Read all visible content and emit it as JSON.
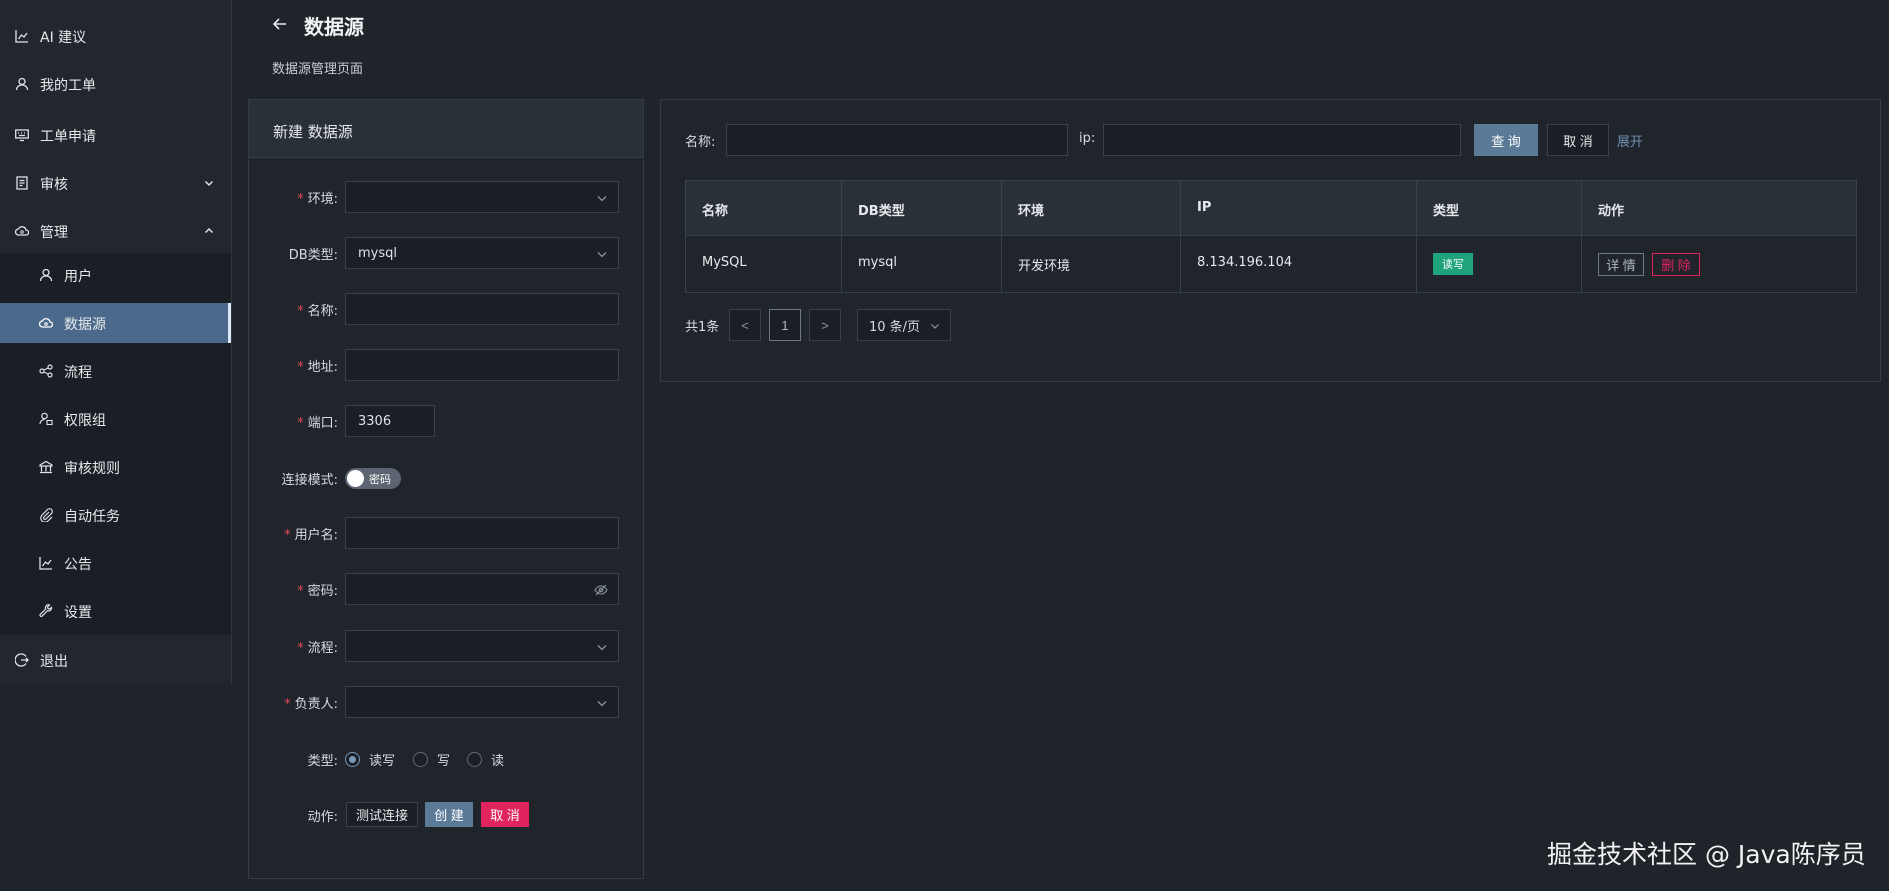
{
  "sidebar": {
    "items": [
      {
        "label": "AI 建议",
        "icon": "chart-icon"
      },
      {
        "label": "我的工单",
        "icon": "user-icon"
      },
      {
        "label": "工单申请",
        "icon": "keyboard-icon"
      },
      {
        "label": "审核",
        "icon": "clipboard-icon"
      },
      {
        "label": "管理",
        "icon": "cloud-gear-icon"
      },
      {
        "label": "退出",
        "icon": "logout-icon"
      }
    ],
    "sub_items": [
      {
        "label": "用户",
        "icon": "user-icon"
      },
      {
        "label": "数据源",
        "icon": "cloud-gear-icon",
        "active": true
      },
      {
        "label": "流程",
        "icon": "share-icon"
      },
      {
        "label": "权限组",
        "icon": "user-lock-icon"
      },
      {
        "label": "审核规则",
        "icon": "rule-icon"
      },
      {
        "label": "自动任务",
        "icon": "paperclip-icon"
      },
      {
        "label": "公告",
        "icon": "chart-icon"
      },
      {
        "label": "设置",
        "icon": "wrench-icon"
      }
    ]
  },
  "header": {
    "title": "数据源",
    "subtitle": "数据源管理页面"
  },
  "form": {
    "title": "新建 数据源",
    "fields": {
      "env": {
        "label": "环境:",
        "value": ""
      },
      "db_type": {
        "label": "DB类型:",
        "value": "mysql"
      },
      "name": {
        "label": "名称:",
        "value": ""
      },
      "address": {
        "label": "地址:",
        "value": ""
      },
      "port": {
        "label": "端口:",
        "value": "3306"
      },
      "mode": {
        "label": "连接模式:",
        "value": "密码"
      },
      "username": {
        "label": "用户名:",
        "value": ""
      },
      "password": {
        "label": "密码:",
        "value": ""
      },
      "flow": {
        "label": "流程:",
        "value": ""
      },
      "owner": {
        "label": "负责人:",
        "value": ""
      },
      "type": {
        "label": "类型:",
        "options": [
          "读写",
          "写",
          "读"
        ],
        "selected": "读写"
      },
      "action": {
        "label": "动作:"
      }
    },
    "buttons": {
      "test": "测试连接",
      "create": "创 建",
      "cancel": "取 消"
    }
  },
  "search": {
    "name_label": "名称:",
    "ip_label": "ip:",
    "query": "查 询",
    "reset": "取 消",
    "expand": "展开"
  },
  "table": {
    "columns": [
      "名称",
      "DB类型",
      "环境",
      "IP",
      "类型",
      "动作"
    ],
    "rows": [
      {
        "name": "MySQL",
        "db_type": "mysql",
        "env": "开发环境",
        "ip": "8.134.196.104",
        "type": "读写",
        "detail": "详 情",
        "delete": "删 除"
      }
    ]
  },
  "pagination": {
    "total": "共1条",
    "current": "1",
    "prev": "<",
    "next": ">",
    "page_size": "10 条/页"
  },
  "watermark": "掘金技术社区 @ Java陈序员",
  "colors": {
    "accent": "#5b7a98",
    "danger": "#e0245e",
    "success": "#1fa37c",
    "bg": "#1f242b"
  }
}
